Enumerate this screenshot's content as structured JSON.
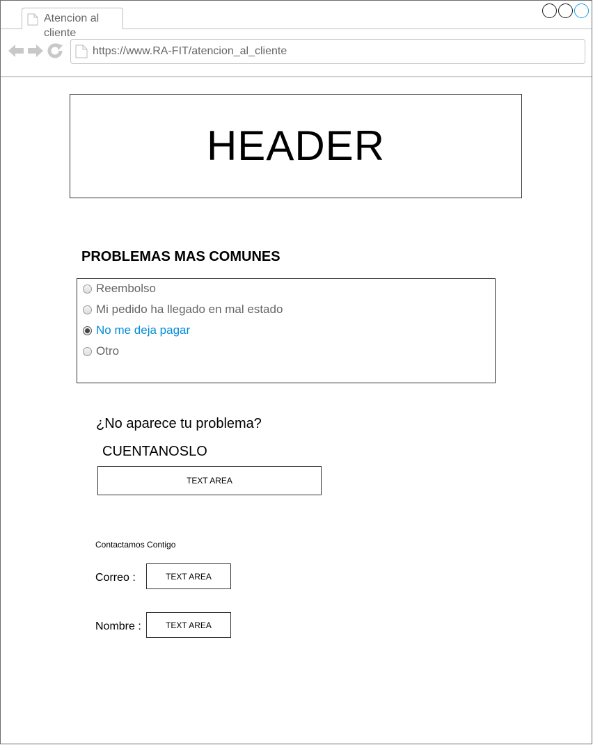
{
  "browser": {
    "tab_title": "Atencion al cliente",
    "url": "https://www.RA-FIT/atencion_al_cliente"
  },
  "header": {
    "text": "HEADER"
  },
  "problems": {
    "title": "PROBLEMAS MAS COMUNES",
    "options": [
      {
        "label": "Reembolso",
        "selected": false
      },
      {
        "label": "Mi pedido ha llegado en mal estado",
        "selected": false
      },
      {
        "label": "No me deja pagar",
        "selected": true
      },
      {
        "label": "Otro",
        "selected": false
      }
    ]
  },
  "custom_problem": {
    "question": "¿No aparece tu problema?",
    "prompt": "CUENTANOSLO",
    "textarea_label": "TEXT AREA"
  },
  "contact": {
    "title": "Contactamos Contigo",
    "email_label": "Correo :",
    "email_placeholder": "TEXT AREA",
    "name_label": "Nombre :",
    "name_placeholder": "TEXT AREA"
  },
  "colors": {
    "selected_option": "#008cdb",
    "window_control_active": "#1ba1e2"
  }
}
